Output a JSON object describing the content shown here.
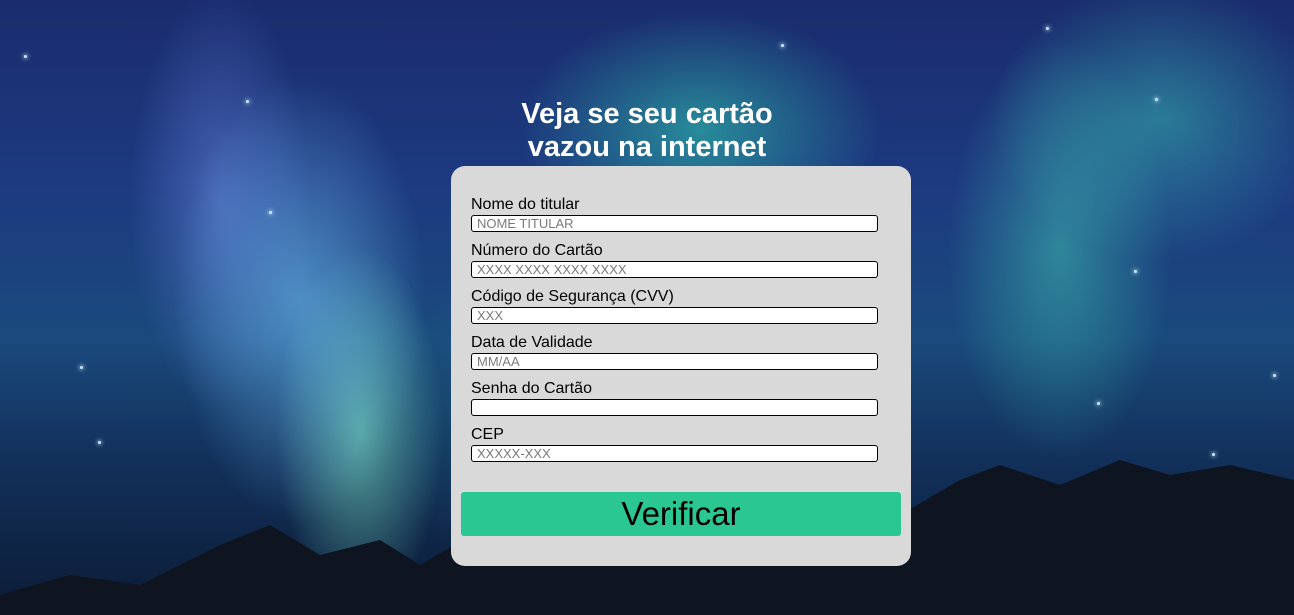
{
  "page": {
    "title_line1": "Veja se seu cartão",
    "title_line2": "vazou na internet"
  },
  "form": {
    "fields": [
      {
        "label": "Nome do titular",
        "placeholder": "NOME TITULAR",
        "value": ""
      },
      {
        "label": "Número do Cartão",
        "placeholder": "XXXX XXXX XXXX XXXX",
        "value": ""
      },
      {
        "label": "Código de Segurança (CVV)",
        "placeholder": "XXX",
        "value": ""
      },
      {
        "label": "Data de Validade",
        "placeholder": "MM/AA",
        "value": ""
      },
      {
        "label": "Senha do Cartão",
        "placeholder": "",
        "value": ""
      },
      {
        "label": "CEP",
        "placeholder": "XXXXX-XXX",
        "value": ""
      }
    ],
    "submit_label": "Verificar"
  },
  "colors": {
    "card_background": "#d9d9d9",
    "button_accent": "#2ac793",
    "title_text": "#ffffff"
  }
}
